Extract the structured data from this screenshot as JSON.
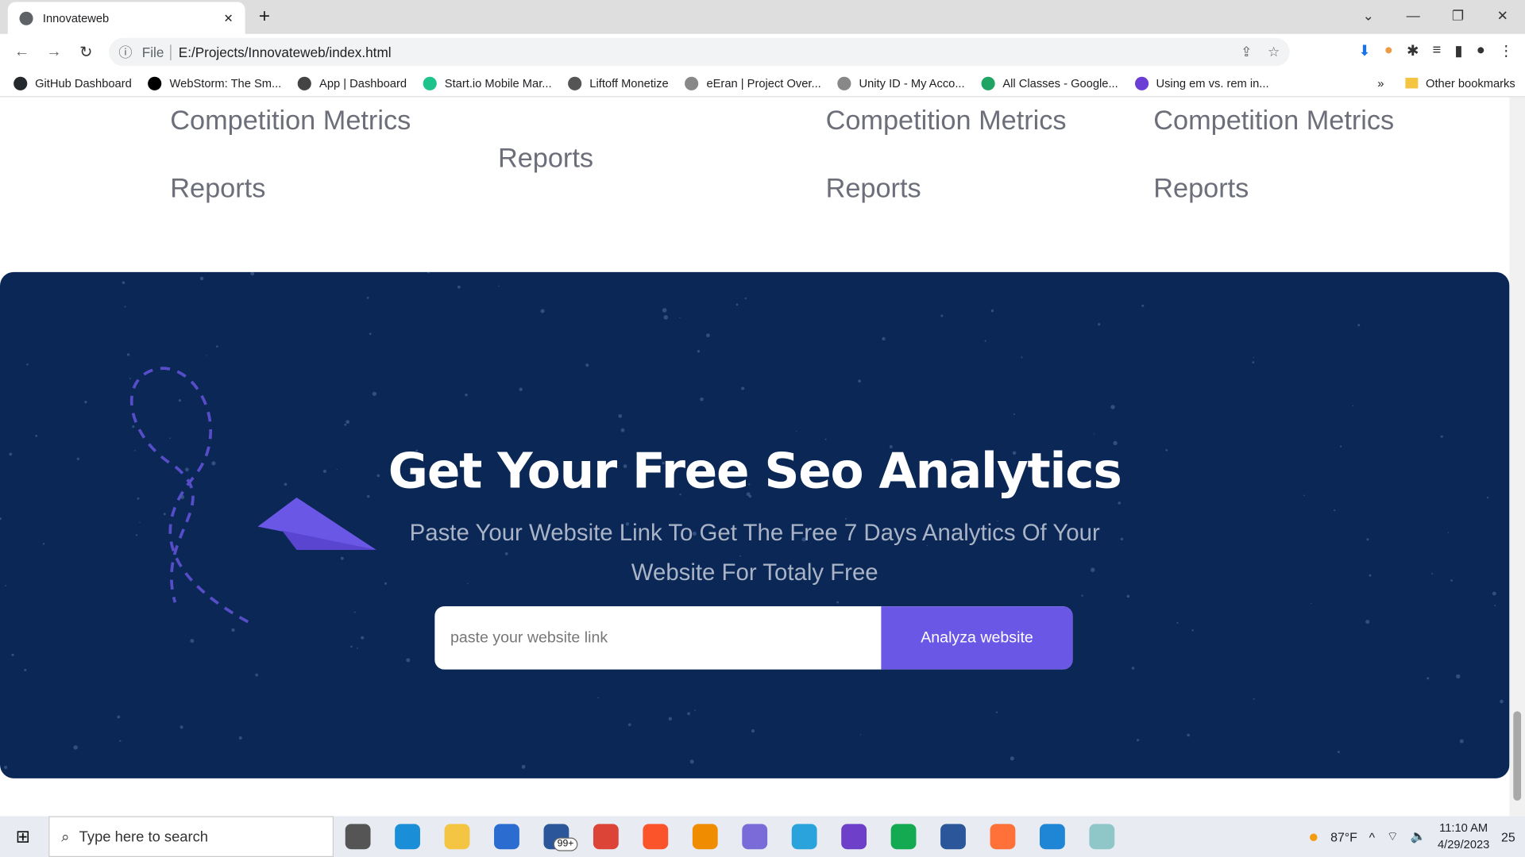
{
  "browser": {
    "tab_title": "Innovateweb",
    "url_scheme": "File",
    "url": "E:/Projects/Innovateweb/index.html",
    "bookmarks": [
      "GitHub Dashboard",
      "WebStorm: The Sm...",
      "App | Dashboard",
      "Start.io Mobile Mar...",
      "Liftoff Monetize",
      "eEran | Project Over...",
      "Unity ID - My Acco...",
      "All Classes - Google...",
      "Using em vs. rem in..."
    ],
    "more": "»",
    "other_bookmarks": "Other bookmarks"
  },
  "features": {
    "col1": [
      "Competition Metrics",
      "Reports"
    ],
    "col2": [
      "Reports"
    ],
    "col3": [
      "Competition Metrics",
      "Reports"
    ],
    "col4": [
      "Competition Metrics",
      "Reports"
    ]
  },
  "cta": {
    "title": "Get Your Free Seo Analytics",
    "subtitle": "Paste Your Website Link To Get The Free 7 Days Analytics Of Your Website For Totaly Free",
    "input_placeholder": "paste your website link",
    "button": "Analyza website",
    "bg_color": "#0a2756",
    "accent": "#6b57e6"
  },
  "taskbar": {
    "search_placeholder": "Type here to search",
    "mail_badge": "99+",
    "weather": "87°F",
    "time": "11:10 AM",
    "date": "4/29/2023",
    "notifications": "25"
  }
}
